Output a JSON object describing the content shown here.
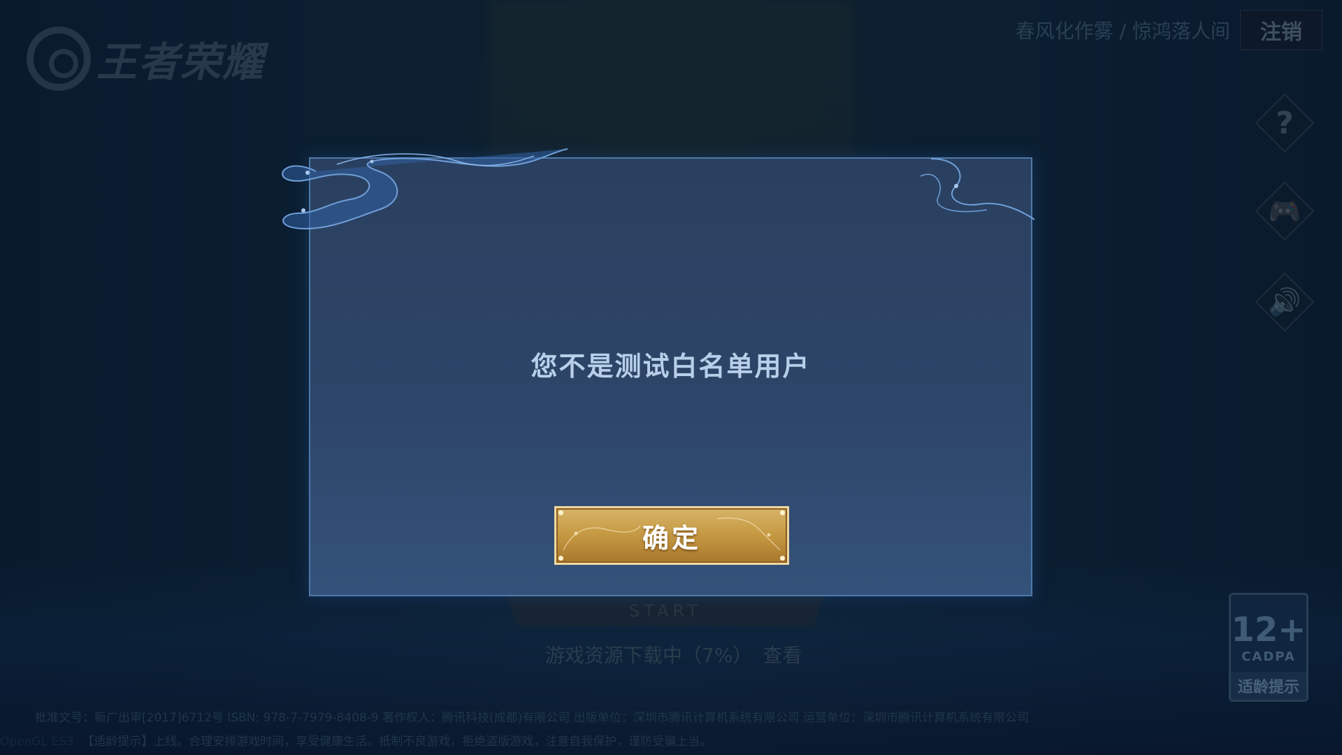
{
  "header": {
    "logo_text": "王者荣耀",
    "account_name": "春风化作雾 / 惊鸿落人间",
    "logout_label": "注销"
  },
  "side_buttons": [
    {
      "icon": "help-icon",
      "glyph": "?"
    },
    {
      "icon": "gamepad-icon",
      "glyph": "🎮"
    },
    {
      "icon": "speaker-icon",
      "glyph": "🔊"
    }
  ],
  "start": {
    "label": "START"
  },
  "download": {
    "status_text": "游戏资源下载中（7%）",
    "progress_percent": 7,
    "view_label": "查看"
  },
  "legal": {
    "line1": "批准文号：新广出审[2017]6712号 ISBN: 978-7-7979-8408-9 著作权人：腾讯科技(成都)有限公司 出版单位：深圳市腾讯计算机系统有限公司 运营单位：深圳市腾讯计算机系统有限公司",
    "engine_label": "OpenGL ES3",
    "line2": "【适龄提示】上线。合理安排游戏时间，享受健康生活。抵制不良游戏，拒绝盗版游戏，注意自我保护，谨防受骗上当。"
  },
  "age_rating": {
    "age": "12+",
    "org": "CADPA",
    "tip": "适龄提示"
  },
  "dialog": {
    "message": "您不是测试白名单用户",
    "confirm_label": "确定",
    "accent_color": "#4f79ab",
    "button_color": "#c79b45"
  }
}
